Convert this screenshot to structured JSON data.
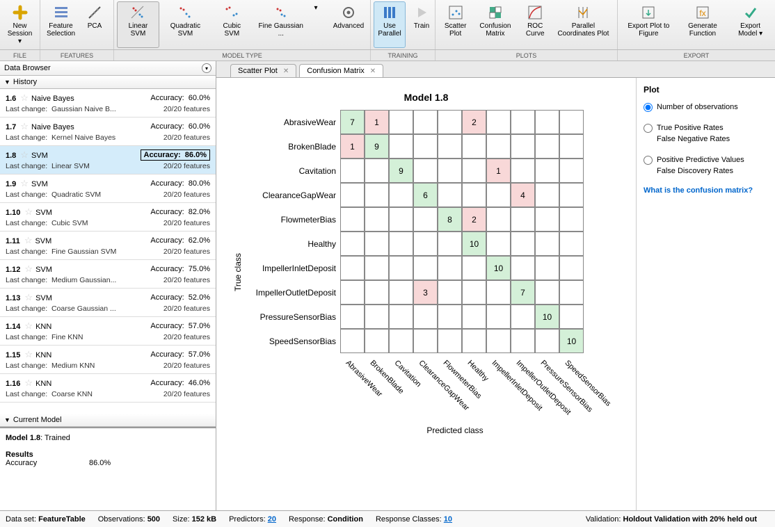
{
  "toolbar": {
    "groups": {
      "file": {
        "label": "FILE",
        "items": [
          {
            "label": "New Session ▾"
          }
        ]
      },
      "features": {
        "label": "FEATURES",
        "items": [
          {
            "label": "Feature Selection"
          },
          {
            "label": "PCA"
          }
        ]
      },
      "model_type": {
        "label": "MODEL TYPE",
        "items": [
          {
            "label": "Linear SVM",
            "sel": true
          },
          {
            "label": "Quadratic SVM"
          },
          {
            "label": "Cubic SVM"
          },
          {
            "label": "Fine Gaussian ..."
          }
        ],
        "more": "▾",
        "advanced": "Advanced"
      },
      "training": {
        "label": "TRAINING",
        "items": [
          {
            "label": "Use Parallel",
            "blue": true
          },
          {
            "label": "Train"
          }
        ]
      },
      "plots": {
        "label": "PLOTS",
        "items": [
          {
            "label": "Scatter Plot"
          },
          {
            "label": "Confusion Matrix"
          },
          {
            "label": "ROC Curve"
          },
          {
            "label": "Parallel Coordinates Plot"
          }
        ]
      },
      "export": {
        "label": "EXPORT",
        "items": [
          {
            "label": "Export Plot to Figure"
          },
          {
            "label": "Generate Function"
          },
          {
            "label": "Export Model ▾"
          }
        ]
      }
    }
  },
  "left": {
    "data_browser_title": "Data Browser",
    "history_title": "History",
    "items": [
      {
        "id": "1.6",
        "name": "Naive Bayes",
        "acc": "60.0%",
        "change": "Gaussian Naive B...",
        "feat": "20/20 features"
      },
      {
        "id": "1.7",
        "name": "Naive Bayes",
        "acc": "60.0%",
        "change": "Kernel Naive Bayes",
        "feat": "20/20 features"
      },
      {
        "id": "1.8",
        "name": "SVM",
        "acc": "86.0%",
        "change": "Linear SVM",
        "feat": "20/20 features",
        "selected": true,
        "boxed": true
      },
      {
        "id": "1.9",
        "name": "SVM",
        "acc": "80.0%",
        "change": "Quadratic SVM",
        "feat": "20/20 features"
      },
      {
        "id": "1.10",
        "name": "SVM",
        "acc": "82.0%",
        "change": "Cubic SVM",
        "feat": "20/20 features"
      },
      {
        "id": "1.11",
        "name": "SVM",
        "acc": "62.0%",
        "change": "Fine Gaussian SVM",
        "feat": "20/20 features"
      },
      {
        "id": "1.12",
        "name": "SVM",
        "acc": "75.0%",
        "change": "Medium Gaussian...",
        "feat": "20/20 features"
      },
      {
        "id": "1.13",
        "name": "SVM",
        "acc": "52.0%",
        "change": "Coarse Gaussian ...",
        "feat": "20/20 features"
      },
      {
        "id": "1.14",
        "name": "KNN",
        "acc": "57.0%",
        "change": "Fine KNN",
        "feat": "20/20 features"
      },
      {
        "id": "1.15",
        "name": "KNN",
        "acc": "57.0%",
        "change": "Medium KNN",
        "feat": "20/20 features"
      },
      {
        "id": "1.16",
        "name": "KNN",
        "acc": "46.0%",
        "change": "Coarse KNN",
        "feat": "20/20 features"
      }
    ],
    "change_prefix": "Last change:",
    "acc_prefix": "Accuracy:",
    "current_model_title": "Current Model",
    "cm_model": "Model 1.8",
    "cm_status": ": Trained",
    "cm_results_label": "Results",
    "cm_acc_label": "Accuracy",
    "cm_acc_val": "86.0%"
  },
  "tabs": [
    {
      "label": "Scatter Plot",
      "active": false
    },
    {
      "label": "Confusion Matrix",
      "active": true
    }
  ],
  "chart_data": {
    "type": "heatmap",
    "title": "Model 1.8",
    "xlabel": "Predicted class",
    "ylabel": "True class",
    "categories": [
      "AbrasiveWear",
      "BrokenBlade",
      "Cavitation",
      "ClearanceGapWear",
      "FlowmeterBias",
      "Healthy",
      "ImpellerInletDeposit",
      "ImpellerOutletDeposit",
      "PressureSensorBias",
      "SpeedSensorBias"
    ],
    "matrix": [
      [
        7,
        1,
        null,
        null,
        null,
        2,
        null,
        null,
        null,
        null
      ],
      [
        1,
        9,
        null,
        null,
        null,
        null,
        null,
        null,
        null,
        null
      ],
      [
        null,
        null,
        9,
        null,
        null,
        null,
        1,
        null,
        null,
        null
      ],
      [
        null,
        null,
        null,
        6,
        null,
        null,
        null,
        4,
        null,
        null
      ],
      [
        null,
        null,
        null,
        null,
        8,
        2,
        null,
        null,
        null,
        null
      ],
      [
        null,
        null,
        null,
        null,
        null,
        10,
        null,
        null,
        null,
        null
      ],
      [
        null,
        null,
        null,
        null,
        null,
        null,
        10,
        null,
        null,
        null
      ],
      [
        null,
        null,
        null,
        3,
        null,
        null,
        null,
        7,
        null,
        null
      ],
      [
        null,
        null,
        null,
        null,
        null,
        null,
        null,
        null,
        10,
        null
      ],
      [
        null,
        null,
        null,
        null,
        null,
        null,
        null,
        null,
        null,
        10
      ]
    ]
  },
  "right": {
    "title": "Plot",
    "opt1": "Number of observations",
    "opt2a": "True Positive Rates",
    "opt2b": "False Negative Rates",
    "opt3a": "Positive Predictive Values",
    "opt3b": "False Discovery Rates",
    "help": "What is the confusion matrix?"
  },
  "status": {
    "dataset_label": "Data set:",
    "dataset": "FeatureTable",
    "obs_label": "Observations:",
    "obs": "500",
    "size_label": "Size:",
    "size": "152 kB",
    "pred_label": "Predictors:",
    "pred": "20",
    "resp_label": "Response:",
    "resp": "Condition",
    "respcls_label": "Response Classes:",
    "respcls": "10",
    "valid_label": "Validation:",
    "valid": "Holdout Validation with 20% held out"
  }
}
